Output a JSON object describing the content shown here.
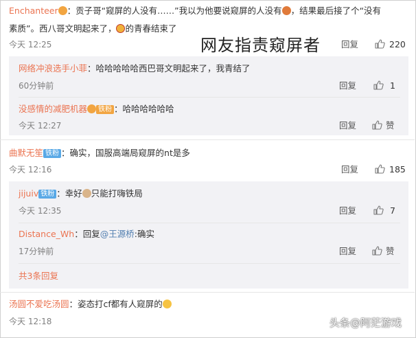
{
  "overlay_title": "网友指责窥屏者",
  "watermark": "头条@阿茫游戏",
  "labels": {
    "reply": "回复",
    "like": "赞"
  },
  "c1": {
    "user": "Enchanteer",
    "text_line1": "：贡子哥“窥屏的人没有……”我以为他要说窥屏的人没有",
    "text_line1b": "，结果最后接了个“没有",
    "text_line2": "素质”。西八哥文明起来了，",
    "text_line2b": "的青春结束了",
    "time": "今天 12:25",
    "likes": "220"
  },
  "c1r1": {
    "user": "网络冲浪选手小菲",
    "text": "：哈哈哈哈哈西巴哥文明起来了，我青结了",
    "time": "60分钟前",
    "likes": "1"
  },
  "c1r2": {
    "user": "没感情的减肥机器",
    "badge": "铁粉",
    "text": "：哈哈哈哈哈哈",
    "time": "今天 12:27"
  },
  "c2": {
    "user": "曲默无笙",
    "badge": "铁粉",
    "text": "：确实，国服高端局窥屏的nt是多",
    "time": "今天 12:16",
    "likes": "185"
  },
  "c2r1": {
    "user": "jijuiv",
    "badge": "铁粉",
    "text": "：幸好",
    "text_b": "只能打嗨铁局",
    "time": "今天 12:35",
    "likes": "7"
  },
  "c2r2": {
    "user": "Distance_Wh",
    "text_a": "：回复",
    "mention": "@王源桥",
    "text_b": ":确实",
    "time": "17分钟前"
  },
  "c2_more": "共3条回复",
  "c3": {
    "user": "汤圆不爱吃汤圆",
    "text": "：姿态打cf都有人窥屏的",
    "time": "今天 12:18"
  },
  "colors": {
    "name": "#eb7350",
    "link": "#507daf",
    "badge": "#5aa9e6",
    "sub_bg": "#f2f2f5"
  }
}
